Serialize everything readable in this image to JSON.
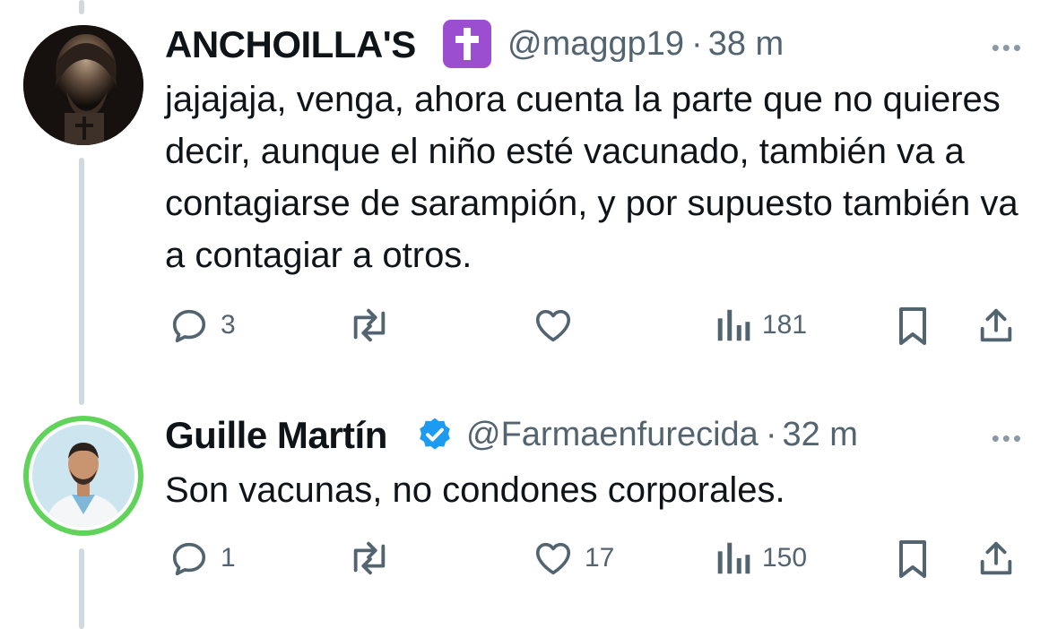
{
  "tweets": [
    {
      "display_name": "ANCHOILLA'S",
      "name_badge": "latin-cross-emoji",
      "handle": "@maggp19",
      "separator": "·",
      "time": "38 m",
      "text": "jajajaja, venga, ahora cuenta  la parte que no quieres decir, aunque el niño esté vacunado, también va a contagiarse de sarampión, y por supuesto también va a contagiar a otros.",
      "replies": "3",
      "retweets": "",
      "likes": "",
      "views": "181"
    },
    {
      "display_name": "Guille Martín",
      "name_badge": "verified-badge",
      "handle": "@Farmaenfurecida",
      "separator": "·",
      "time": "32 m",
      "text": "Son vacunas, no condones corporales.",
      "replies": "1",
      "retweets": "",
      "likes": "17",
      "views": "150"
    }
  ],
  "ui": {
    "more_glyph": "•••"
  },
  "colors": {
    "text": "#0f1419",
    "secondary": "#536471",
    "thread_line": "#cfd9de",
    "verified": "#1d9bf0",
    "cross_badge": "#9b4fd0",
    "avatar_ring": "#5fd35a"
  }
}
